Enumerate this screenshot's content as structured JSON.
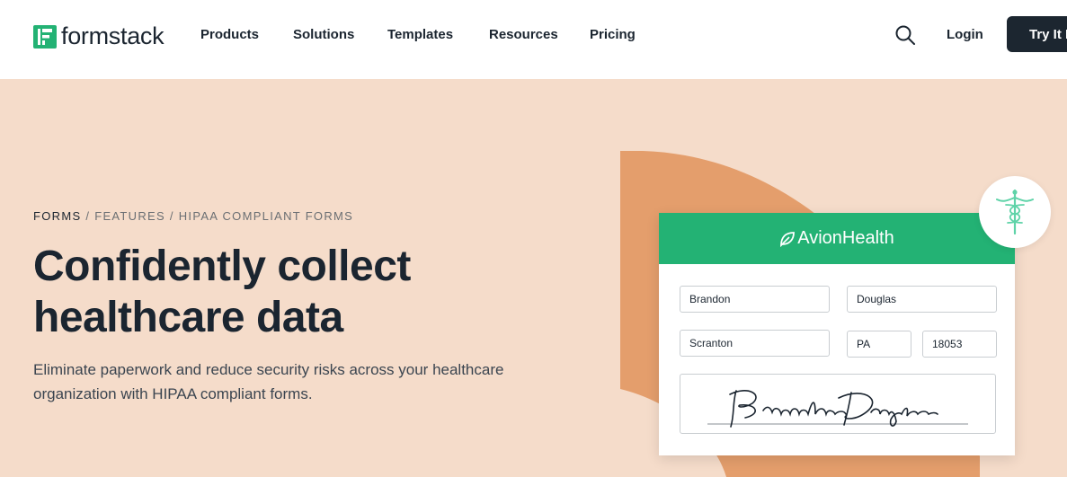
{
  "nav": {
    "logo_text": "formstack",
    "links": [
      "Products",
      "Solutions",
      "Templates",
      "Resources",
      "Pricing"
    ],
    "login": "Login",
    "cta": "Try It Free"
  },
  "breadcrumb": {
    "items": [
      "FORMS",
      "FEATURES",
      "HIPAA COMPLIANT FORMS"
    ],
    "separator": " / "
  },
  "hero": {
    "title": "Confidently collect healthcare data",
    "subtitle": "Eliminate paperwork and reduce security risks across your healthcare organization with HIPAA compliant forms."
  },
  "form_card": {
    "brand_name": "AvionHealth",
    "first_name": "Brandon",
    "last_name": "Douglas",
    "city": "Scranton",
    "state": "PA",
    "zip": "18053",
    "signature": "Brandon Douglas"
  },
  "colors": {
    "background": "#f5dcca",
    "accent_green": "#23b274",
    "blob": "#e49e6c",
    "dark": "#1c2630",
    "badge_icon": "#5fd3a8"
  },
  "icons": {
    "logo": "formstack-logo-icon",
    "search": "search-icon",
    "brand": "leaf-icon",
    "badge": "caduceus-icon"
  }
}
